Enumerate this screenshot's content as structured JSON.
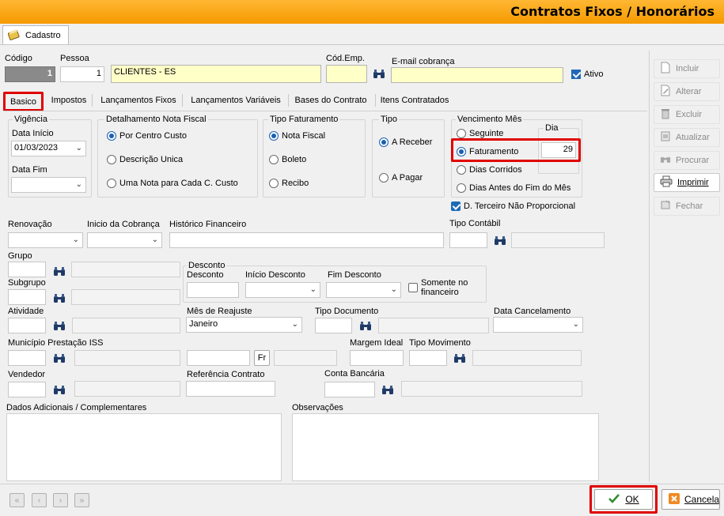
{
  "window": {
    "title": "Contratos Fixos / Honorários"
  },
  "top_tab": {
    "label": "Cadastro"
  },
  "header": {
    "codigo_label": "Código",
    "codigo_value": "1",
    "pessoa_label": "Pessoa",
    "pessoa_value": "1",
    "pessoa_name": "CLIENTES - ES",
    "cod_emp_label": "Cód.Emp.",
    "cod_emp_value": "",
    "email_label": "E-mail cobrança",
    "email_value": "",
    "ativo_label": "Ativo",
    "ativo_checked": true
  },
  "tabs": [
    "Basico",
    "Impostos",
    "Lançamentos Fixos",
    "Lançamentos Variáveis",
    "Bases do Contrato",
    "Itens Contratados"
  ],
  "vigencia": {
    "title": "Vigência",
    "data_inicio_label": "Data Início",
    "data_inicio_value": "01/03/2023",
    "data_fim_label": "Data Fim",
    "data_fim_value": ""
  },
  "detalhamento": {
    "title": "Detalhamento Nota Fiscal",
    "options": [
      "Por Centro Custo",
      "Descrição Unica",
      "Uma Nota para Cada C. Custo"
    ],
    "selected": 0
  },
  "tipo_faturamento": {
    "title": "Tipo Faturamento",
    "options": [
      "Nota Fiscal",
      "Boleto",
      "Recibo"
    ],
    "selected": 0
  },
  "tipo": {
    "title": "Tipo",
    "options": [
      "A Receber",
      "A Pagar"
    ],
    "selected": 0
  },
  "vencimento": {
    "title": "Vencimento Mês",
    "dia_label": "Dia",
    "dia_value": "29",
    "options": [
      "Seguinte",
      "Faturamento",
      "Dias Corridos",
      "Dias Antes do Fim do Mês"
    ],
    "selected": 1
  },
  "terceiro": {
    "label": "D. Terceiro Não Proporcional",
    "checked": true
  },
  "fields": {
    "renovacao_label": "Renovação",
    "renovacao_value": "",
    "inicio_cobranca_label": "Inicio da Cobrança",
    "inicio_cobranca_value": "",
    "historico_label": "Histórico Financeiro",
    "historico_value": "",
    "tipo_contabil_label": "Tipo Contábil",
    "grupo_label": "Grupo",
    "subgrupo_label": "Subgrupo",
    "desconto_group_title": "Desconto",
    "desconto_label": "Desconto",
    "inicio_desconto_label": "Início Desconto",
    "fim_desconto_label": "Fim Desconto",
    "somente_financeiro_label": "Somente no financeiro",
    "atividade_label": "Atividade",
    "mes_reajuste_label": "Mês de Reajuste",
    "mes_reajuste_value": "Janeiro",
    "tipo_documento_label": "Tipo Documento",
    "data_cancelamento_label": "Data Cancelamento",
    "municipio_label": "Município Prestação ISS",
    "fr_label": "Fr",
    "margem_label": "Margem Ideal",
    "tipo_movimento_label": "Tipo Movimento",
    "vendedor_label": "Vendedor",
    "referencia_label": "Referência Contrato",
    "conta_bancaria_label": "Conta Bancária",
    "dados_adicionais_label": "Dados Adicionais / Complementares",
    "observacoes_label": "Observações"
  },
  "side_buttons": [
    {
      "label": "Incluir",
      "icon": "new-doc-icon",
      "enabled": false
    },
    {
      "label": "Alterar",
      "icon": "edit-icon",
      "enabled": false
    },
    {
      "label": "Excluir",
      "icon": "trash-icon",
      "enabled": false
    },
    {
      "label": "Atualizar",
      "icon": "refresh-icon",
      "enabled": false
    },
    {
      "label": "Procurar",
      "icon": "binoculars-icon",
      "enabled": false
    },
    {
      "label": "Imprimir",
      "icon": "printer-icon",
      "enabled": true
    },
    {
      "label": "Fechar",
      "icon": "close-icon",
      "enabled": false
    }
  ],
  "bottom": {
    "ok_label": "OK",
    "cancel_label": "Cancela"
  },
  "colors": {
    "title_gradient_top": "#ffb733",
    "title_gradient_bottom": "#f59a00",
    "highlight": "#e00000",
    "field_yellow": "#ffffc8"
  }
}
